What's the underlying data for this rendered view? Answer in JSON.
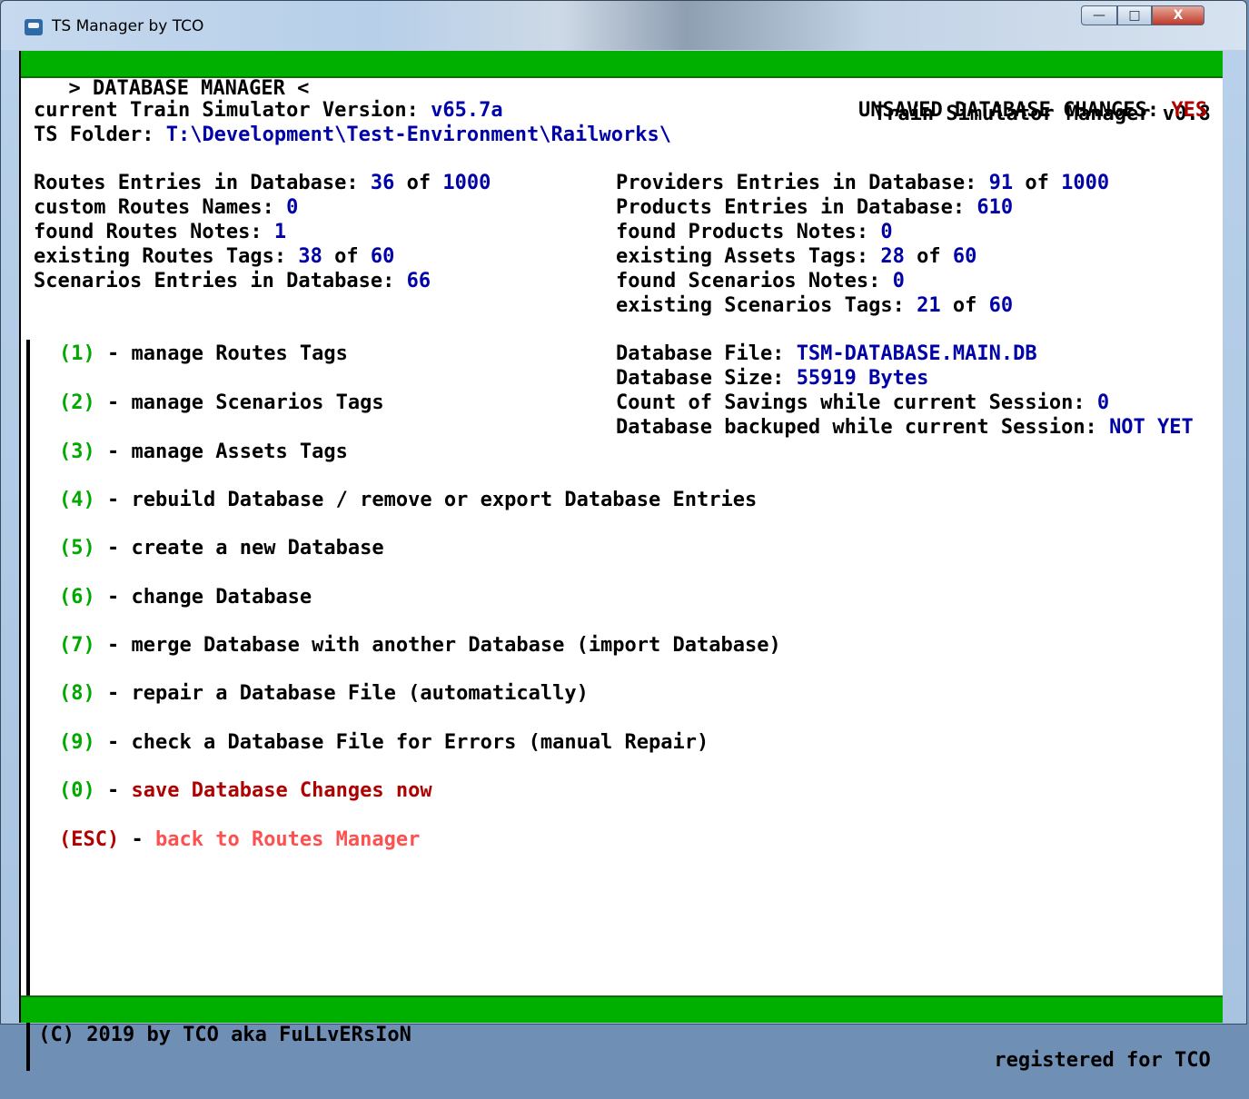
{
  "window": {
    "title": "TS Manager by TCO",
    "min_glyph": "—",
    "max_glyph": "□",
    "close_glyph": "X"
  },
  "header": {
    "left": "  > DATABASE MANAGER <",
    "right": "Train Simulator Manager v0.8 "
  },
  "info": {
    "version_label": "current Train Simulator Version: ",
    "version": "v65.7a",
    "unsaved_label": "UNSAVED DATABASE CHANGES: ",
    "unsaved": "YES",
    "folder_label": "TS Folder: ",
    "folder": "T:\\Development\\Test-Environment\\Railworks\\"
  },
  "stats_left": {
    "routes_label": "Routes Entries in Database: ",
    "routes": "36",
    "routes_of": " of ",
    "routes_max": "1000",
    "custom_names_label": "custom Routes Names: ",
    "custom_names": "0",
    "routes_notes_label": "found Routes Notes: ",
    "routes_notes": "1",
    "routes_tags_label": "existing Routes Tags: ",
    "routes_tags": "38",
    "routes_tags_of": " of ",
    "routes_tags_max": "60",
    "scenarios_label": "Scenarios Entries in Database: ",
    "scenarios": "66"
  },
  "stats_right": {
    "providers_label": "Providers Entries in Database: ",
    "providers": "91",
    "providers_of": " of ",
    "providers_max": "1000",
    "products_label": "Products Entries in Database: ",
    "products": "610",
    "products_notes_label": "found Products Notes: ",
    "products_notes": "0",
    "assets_tags_label": "existing Assets Tags: ",
    "assets_tags": "28",
    "assets_tags_of": " of ",
    "assets_tags_max": "60",
    "scen_notes_label": "found Scenarios Notes: ",
    "scen_notes": "0",
    "scen_tags_label": "existing Scenarios Tags: ",
    "scen_tags": "21",
    "scen_tags_of": " of ",
    "scen_tags_max": "60"
  },
  "db": {
    "file_label": "Database File: ",
    "file": "TSM-DATABASE.MAIN.DB",
    "size_label": "Database Size: ",
    "size": "55919 Bytes",
    "savings_label": "Count of Savings while current Session: ",
    "savings": "0",
    "backup_label": "Database backuped while current Session: ",
    "backup": "NOT YET"
  },
  "menu": [
    {
      "key": "(1)",
      "sep": " - ",
      "label": "manage Routes Tags"
    },
    {
      "key": "(2)",
      "sep": " - ",
      "label": "manage Scenarios Tags"
    },
    {
      "key": "(3)",
      "sep": " - ",
      "label": "manage Assets Tags"
    },
    {
      "key": "(4)",
      "sep": " - ",
      "label": "rebuild Database / remove or export Database Entries"
    },
    {
      "key": "(5)",
      "sep": " - ",
      "label": "create a new Database"
    },
    {
      "key": "(6)",
      "sep": " - ",
      "label": "change Database"
    },
    {
      "key": "(7)",
      "sep": " - ",
      "label": "merge Database with another Database (import Database)"
    },
    {
      "key": "(8)",
      "sep": " - ",
      "label": "repair a Database File (automatically)"
    },
    {
      "key": "(9)",
      "sep": " - ",
      "label": "check a Database File for Errors (manual Repair)"
    },
    {
      "key": "(0)",
      "sep": " - ",
      "label": "save Database Changes now"
    },
    {
      "key": "(ESC)",
      "sep": " - ",
      "label": "back to Routes Manager"
    }
  ],
  "footer": {
    "left": " (C) 2019 by TCO aka FuLLvERsIoN",
    "right": "registered for TCO "
  }
}
